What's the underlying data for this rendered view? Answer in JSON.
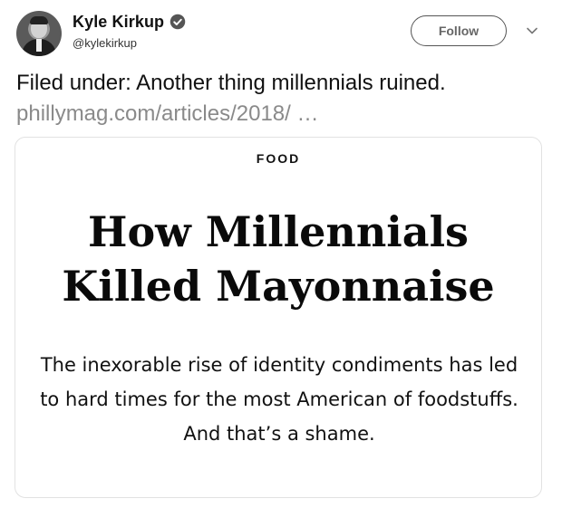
{
  "tweet": {
    "author_name": "Kyle Kirkup",
    "author_handle": "@kylekirkup",
    "follow_label": "Follow",
    "text": "Filed under: Another thing millennials ruined.",
    "link": "phillymag.com/articles/2018/ …"
  },
  "card": {
    "category": "FOOD",
    "headline_line1": "How Millennials",
    "headline_line2": "Killed Mayonnaise",
    "subhead": "The inexorable rise of identity condiments has led to hard times for the most American of foodstuffs. And that’s a shame."
  },
  "icons": {
    "verified": "verified-badge-icon",
    "menu": "chevron-down-icon"
  }
}
